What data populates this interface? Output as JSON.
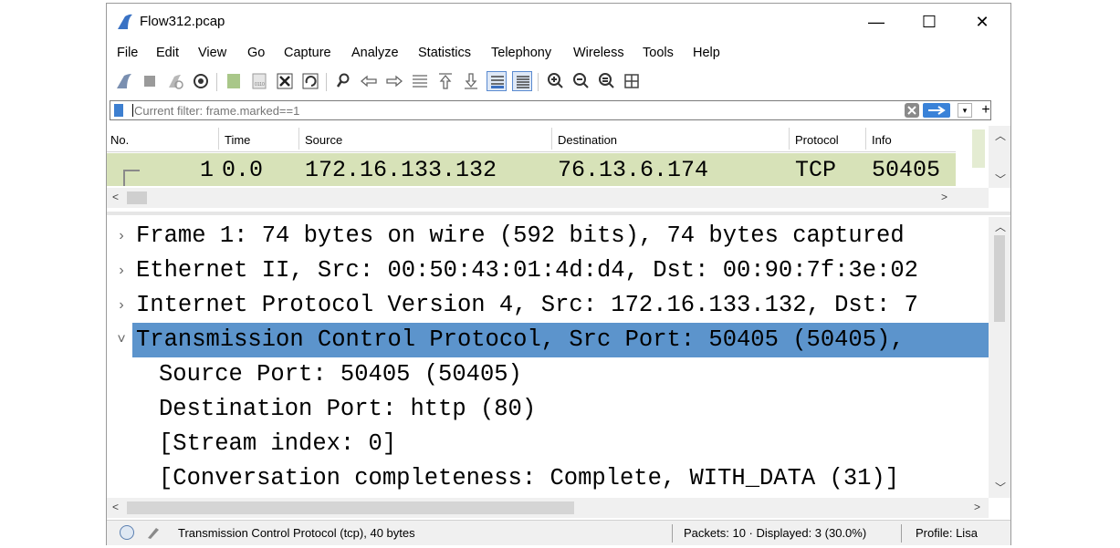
{
  "window": {
    "title": "Flow312.pcap",
    "minimize": "—",
    "maximize": "☐",
    "close": "✕"
  },
  "menu": [
    "File",
    "Edit",
    "View",
    "Go",
    "Capture",
    "Analyze",
    "Statistics",
    "Telephony",
    "Wireless",
    "Tools",
    "Help"
  ],
  "toolbar_icons": [
    "shark-fin-start-icon",
    "stop-icon",
    "restart-icon",
    "options-gear-icon",
    "open-file-icon",
    "save-file-icon",
    "close-file-icon",
    "reload-icon",
    "find-packet-icon",
    "go-back-icon",
    "go-forward-icon",
    "go-to-packet-icon",
    "go-first-icon",
    "go-last-icon",
    "auto-scroll-icon",
    "colorize-icon",
    "zoom-in-icon",
    "zoom-out-icon",
    "zoom-reset-icon",
    "resize-columns-icon"
  ],
  "filter": {
    "placeholder": "Current filter: frame.marked==1",
    "plus": "+"
  },
  "packet_list": {
    "columns": [
      "No.",
      "Time",
      "Source",
      "Destination",
      "Protocol",
      "Info"
    ],
    "rows": [
      {
        "no": "1",
        "time": "0.0",
        "source": "172.16.133.132",
        "destination": "76.13.6.174",
        "protocol": "TCP",
        "info": "50405"
      }
    ],
    "row_color": "#d7e2b8"
  },
  "details": {
    "rows": [
      {
        "expander": "›",
        "text": "Frame 1: 74 bytes on wire (592 bits), 74 bytes captured",
        "selected": false
      },
      {
        "expander": "›",
        "text": "Ethernet II, Src: 00:50:43:01:4d:d4, Dst: 00:90:7f:3e:02",
        "selected": false
      },
      {
        "expander": "›",
        "text": "Internet Protocol Version 4, Src: 172.16.133.132, Dst: 7",
        "selected": false
      },
      {
        "expander": "˅",
        "text": "Transmission Control Protocol, Src Port: 50405 (50405),",
        "selected": true
      },
      {
        "expander": "",
        "text": "Source Port: 50405 (50405)",
        "selected": false
      },
      {
        "expander": "",
        "text": "Destination Port: http (80)",
        "selected": false
      },
      {
        "expander": "",
        "text": "[Stream index: 0]",
        "selected": false
      },
      {
        "expander": "",
        "text": "[Conversation completeness: Complete, WITH_DATA (31)]",
        "selected": false
      }
    ],
    "selection_color": "#5c94cc"
  },
  "status": {
    "field_text": "Transmission Control Protocol (tcp), 40 bytes",
    "packets": "Packets: 10 · Displayed: 3 (30.0%)",
    "profile": "Profile: Lisa"
  }
}
